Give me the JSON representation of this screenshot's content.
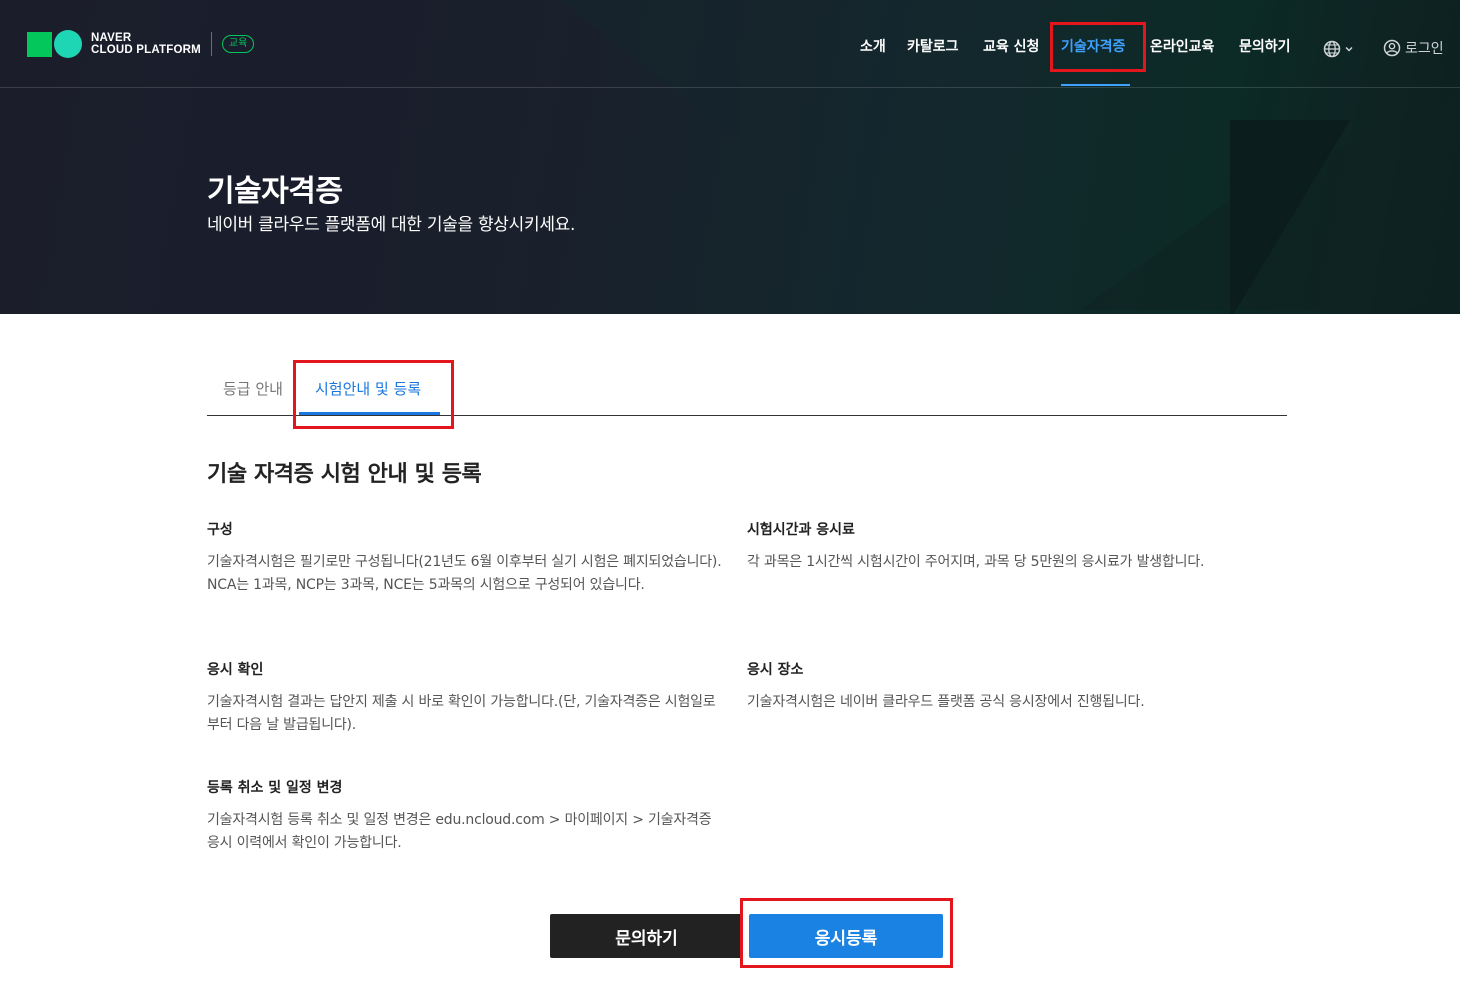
{
  "header": {
    "logo_line1": "NAVER",
    "logo_line2": "CLOUD PLATFORM",
    "logo_badge": "교육",
    "nav_items": [
      {
        "label": "소개"
      },
      {
        "label": "카탈로그"
      },
      {
        "label": "교육 신청"
      },
      {
        "label": "기술자격증",
        "active": true
      },
      {
        "label": "온라인교육"
      },
      {
        "label": "문의하기"
      }
    ],
    "language_icon": "globe-icon",
    "login_icon": "user-circle-icon",
    "login_label": "로그인",
    "active_color": "#3fa2ff"
  },
  "hero": {
    "title": "기술자격증",
    "subtitle": "네이버 클라우드 플랫폼에 대한 기술을 향상시키세요."
  },
  "tabs": [
    {
      "label": "등급 안내",
      "active": false
    },
    {
      "label": "시험안내 및 등록",
      "active": true
    }
  ],
  "main": {
    "section_title": "기술 자격증 시험 안내 및 등록",
    "blocks": [
      {
        "title": "구성",
        "body": "기술자격시험은 필기로만 구성됩니다(21년도 6월 이후부터 실기 시험은 폐지되었습니다). NCA는 1과목, NCP는 3과목, NCE는 5과목의 시험으로 구성되어 있습니다."
      },
      {
        "title": "시험시간과 응시료",
        "body": "각 과목은 1시간씩 시험시간이 주어지며, 과목 당 5만원의 응시료가 발생합니다."
      },
      {
        "title": "응시 확인",
        "body": "기술자격시험 결과는 답안지 제출 시 바로 확인이 가능합니다.(단, 기술자격증은 시험일로부터 다음 날 발급됩니다)."
      },
      {
        "title": "응시 장소",
        "body": "기술자격시험은 네이버 클라우드 플랫폼 공식 응시장에서 진행됩니다."
      },
      {
        "title": "등록 취소 및 일정 변경",
        "body": "기술자격시험 등록 취소 및 일정 변경은 edu.ncloud.com > 마이페이지 > 기술자격증 응시 이력에서 확인이 가능합니다."
      }
    ],
    "buttons": {
      "inquiry": "문의하기",
      "register": "응시등록"
    }
  },
  "colors": {
    "highlight_box": "#e3161e",
    "primary_blue": "#1a82e3",
    "brand_green": "#03c75a"
  }
}
